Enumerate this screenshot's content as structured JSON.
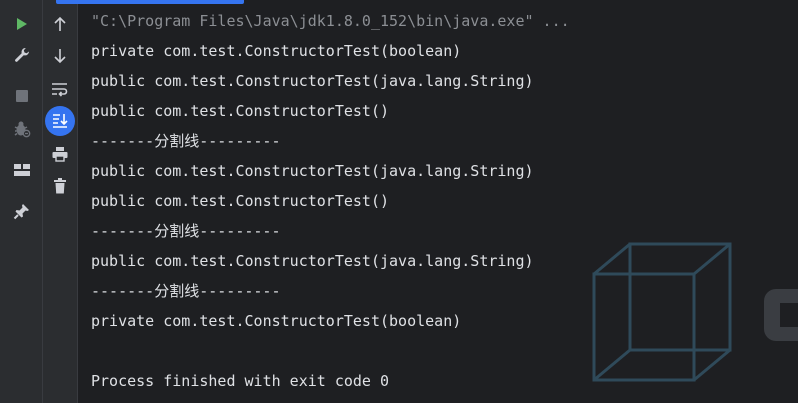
{
  "console": {
    "lines": [
      "\"C:\\Program Files\\Java\\jdk1.8.0_152\\bin\\java.exe\" ...",
      "private com.test.ConstructorTest(boolean)",
      "public com.test.ConstructorTest(java.lang.String)",
      "public com.test.ConstructorTest()",
      "-------分割线---------",
      "public com.test.ConstructorTest(java.lang.String)",
      "public com.test.ConstructorTest()",
      "-------分割线---------",
      "public com.test.ConstructorTest(java.lang.String)",
      "-------分割线---------",
      "private com.test.ConstructorTest(boolean)",
      "",
      "Process finished with exit code 0"
    ]
  },
  "icons": {
    "run": "play-icon",
    "settings": "wrench-icon",
    "stop": "stop-icon",
    "debug": "bug-icon",
    "layout": "layout-icon",
    "pin": "pin-icon",
    "up": "arrow-up-icon",
    "down": "arrow-down-icon",
    "wrap": "soft-wrap-icon",
    "scroll_end": "scroll-to-end-icon",
    "print": "print-icon",
    "clear": "trash-icon"
  },
  "colors": {
    "background": "#1e1f22",
    "toolbar": "#2b2d30",
    "text": "#dfe1e5",
    "accent": "#3574f0",
    "run_green": "#5fb865"
  }
}
